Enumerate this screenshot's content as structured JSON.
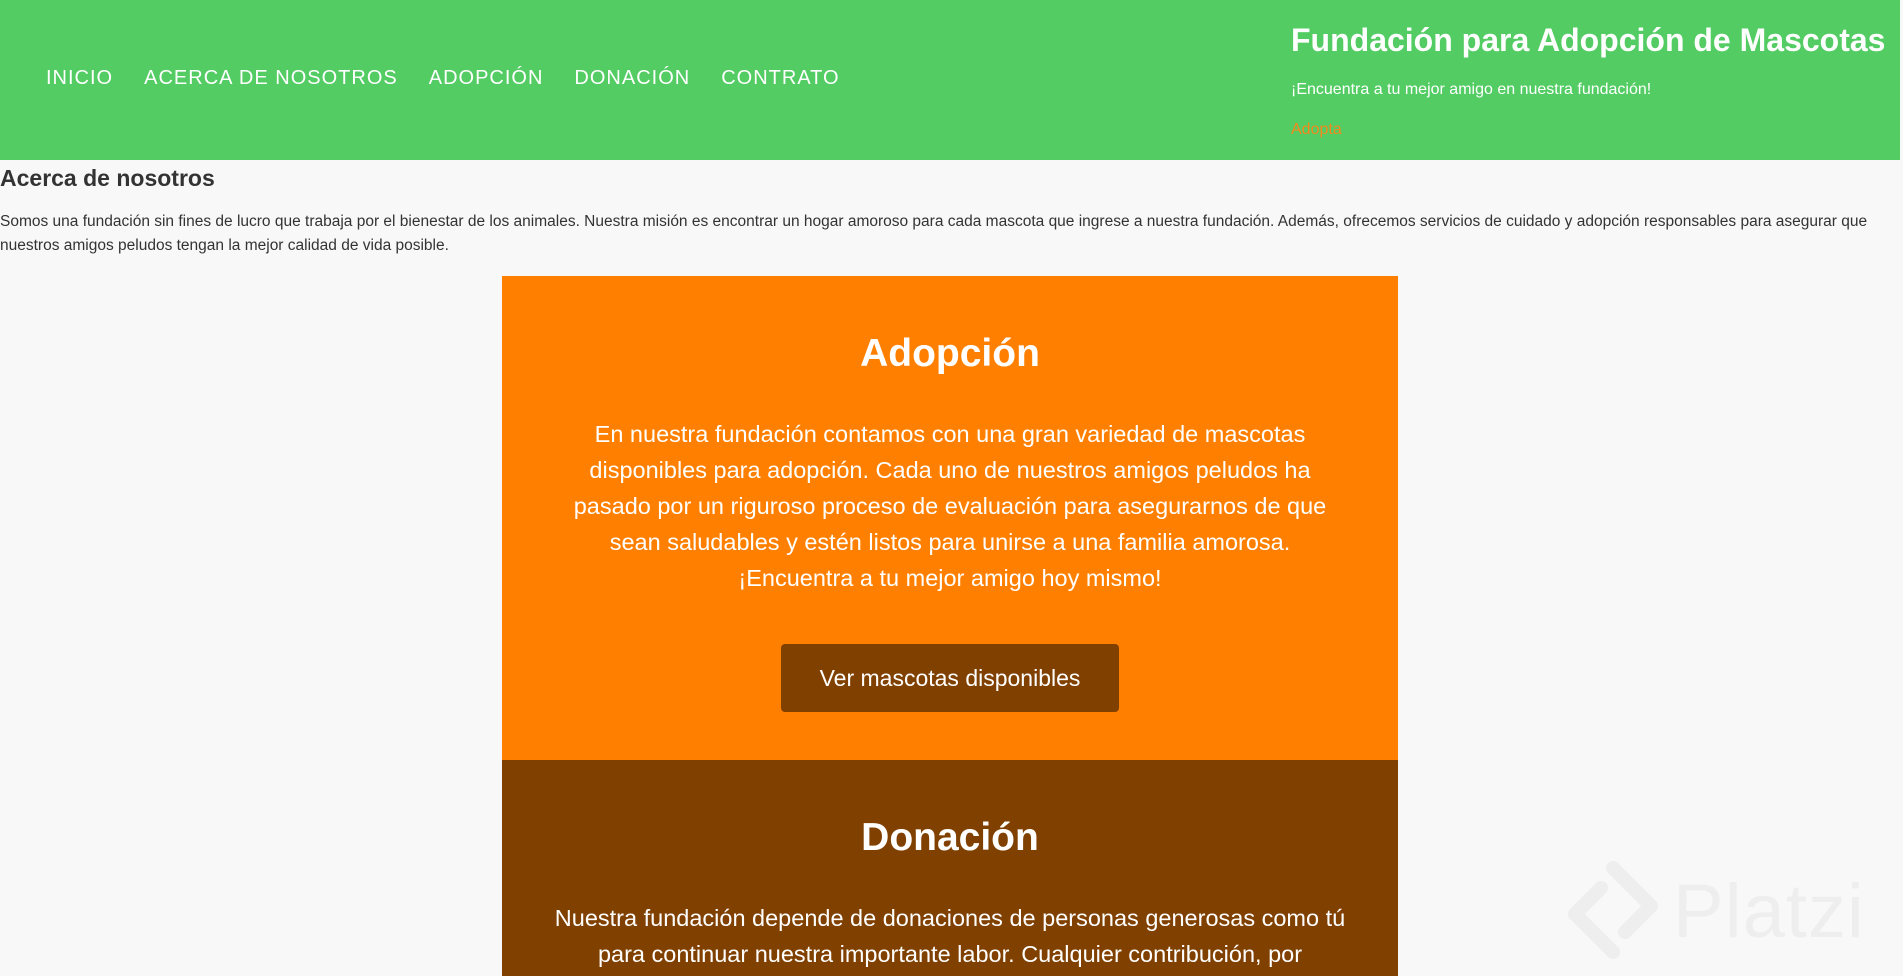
{
  "header": {
    "nav": [
      {
        "label": "INICIO"
      },
      {
        "label": "ACERCA DE NOSOTROS"
      },
      {
        "label": "ADOPCIÓN"
      },
      {
        "label": "DONACIÓN"
      },
      {
        "label": "CONTRATO"
      }
    ],
    "title": "Fundación para Adopción de Mascotas",
    "tagline": "¡Encuentra a tu mejor amigo en nuestra fundación!",
    "link": "Adopta",
    "background_color": "#52cc63",
    "link_color": "#f58a1f"
  },
  "about": {
    "heading": "Acerca de nosotros",
    "body": "Somos una fundación sin fines de lucro que trabaja por el bienestar de los animales. Nuestra misión es encontrar un hogar amoroso para cada mascota que ingrese a nuestra fundación. Además, ofrecemos servicios de cuidado y adopción responsables para asegurar que nuestros amigos peludos tengan la mejor calidad de vida posible."
  },
  "adoption": {
    "heading": "Adopción",
    "body": "En nuestra fundación contamos con una gran variedad de mascotas disponibles para adopción. Cada uno de nuestros amigos peludos ha pasado por un riguroso proceso de evaluación para asegurarnos de que sean saludables y estén listos para unirse a una familia amorosa. ¡Encuentra a tu mejor amigo hoy mismo!",
    "button": "Ver mascotas disponibles",
    "background_color": "#ff8000"
  },
  "donation": {
    "heading": "Donación",
    "body": "Nuestra fundación depende de donaciones de personas generosas como tú para continuar nuestra importante labor. Cualquier contribución, por",
    "background_color": "#804000"
  },
  "watermark": {
    "text": "Platzi",
    "icon": "platzi-logo-icon"
  }
}
